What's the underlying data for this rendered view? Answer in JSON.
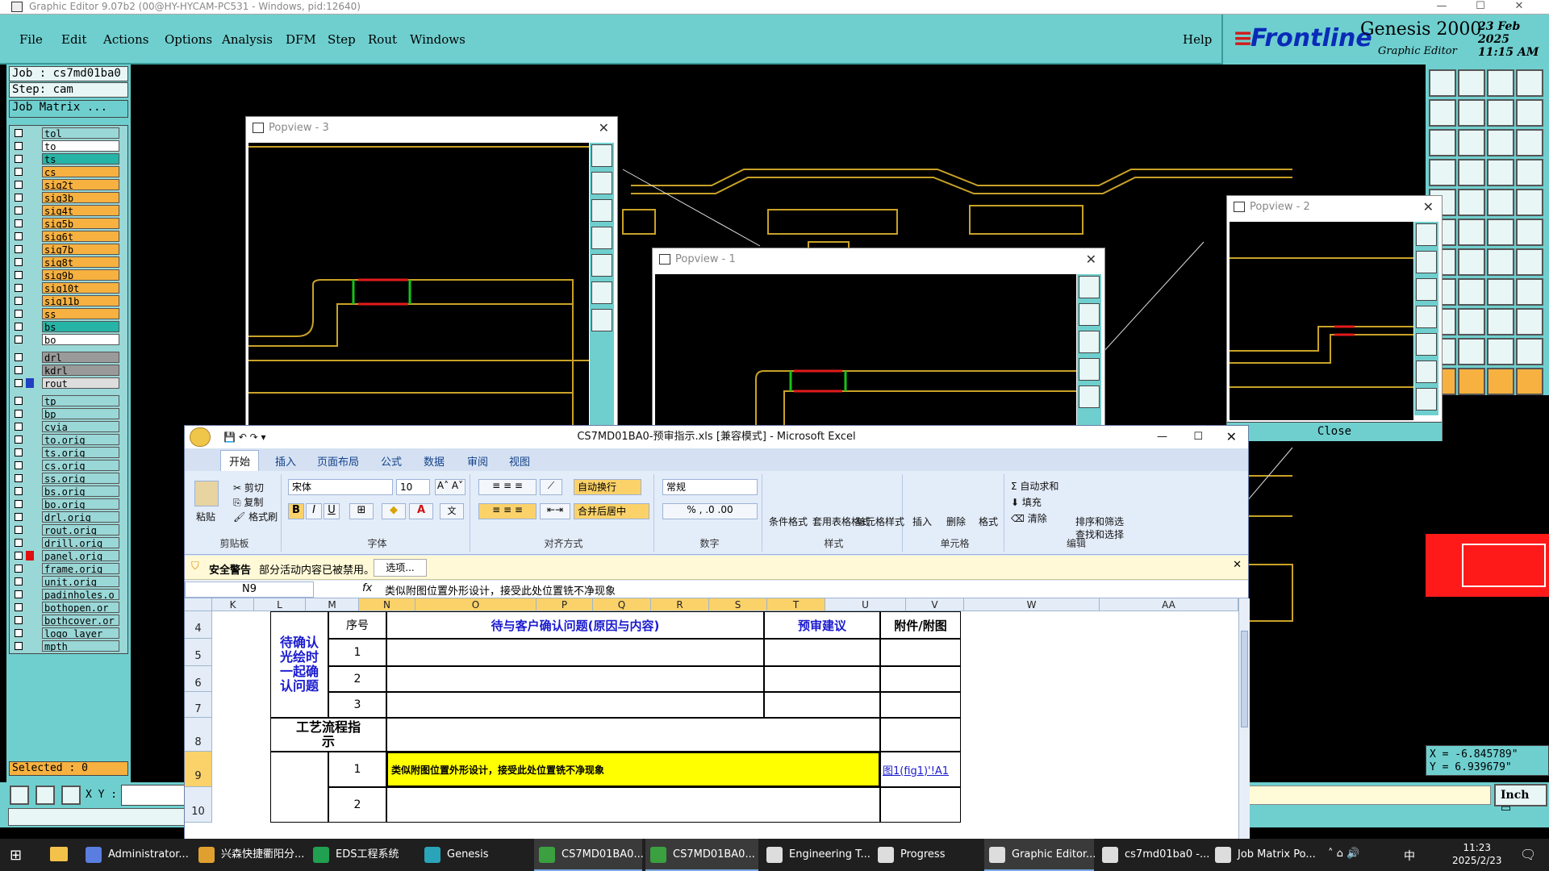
{
  "app_title": "Graphic Editor 9.07b2 (00@HY-HYCAM-PC531 - Windows, pid:12640)",
  "menu": [
    "File",
    "Edit",
    "Actions",
    "Options",
    "Analysis",
    "DFM",
    "Step",
    "Rout",
    "Windows"
  ],
  "help_label": "Help",
  "brand": {
    "logo": "Frontline",
    "product": "Genesis 2000",
    "subtitle": "Graphic Editor",
    "date": "23 Feb 2025",
    "time": "11:15 AM"
  },
  "job": {
    "job_line": "Job : cs7md01ba0",
    "step_line": "Step: cam",
    "matrix_button": "Job Matrix ..."
  },
  "layers": [
    {
      "name": "tol",
      "color": "#9ad7d7"
    },
    {
      "name": "to",
      "color": "#ffffff"
    },
    {
      "name": "ts",
      "color": "#26b4a6"
    },
    {
      "name": "cs",
      "color": "#f7b140"
    },
    {
      "name": "sig2t",
      "color": "#f7b140"
    },
    {
      "name": "sig3b",
      "color": "#f7b140"
    },
    {
      "name": "sig4t",
      "color": "#f7b140"
    },
    {
      "name": "sig5b",
      "color": "#f7b140"
    },
    {
      "name": "sig6t",
      "color": "#f7b140"
    },
    {
      "name": "sig7b",
      "color": "#f7b140"
    },
    {
      "name": "sig8t",
      "color": "#f7b140"
    },
    {
      "name": "sig9b",
      "color": "#f7b140"
    },
    {
      "name": "sig10t",
      "color": "#f7b140"
    },
    {
      "name": "sig11b",
      "color": "#f7b140"
    },
    {
      "name": "ss",
      "color": "#f7b140"
    },
    {
      "name": "bs",
      "color": "#26b4a6"
    },
    {
      "name": "bo",
      "color": "#ffffff"
    },
    {
      "name": "drl",
      "color": "#9a9a9a"
    },
    {
      "name": "kdrl",
      "color": "#9a9a9a"
    },
    {
      "name": "rout",
      "color": "#dddddd"
    },
    {
      "name": "tp",
      "color": "#9ad7d7"
    },
    {
      "name": "bp",
      "color": "#9ad7d7"
    },
    {
      "name": "cvia",
      "color": "#9ad7d7"
    },
    {
      "name": "to.orig",
      "color": "#9ad7d7"
    },
    {
      "name": "ts.orig",
      "color": "#9ad7d7"
    },
    {
      "name": "cs.orig",
      "color": "#9ad7d7"
    },
    {
      "name": "ss.orig",
      "color": "#9ad7d7"
    },
    {
      "name": "bs.orig",
      "color": "#9ad7d7"
    },
    {
      "name": "bo.orig",
      "color": "#9ad7d7"
    },
    {
      "name": "drl.orig",
      "color": "#9ad7d7"
    },
    {
      "name": "rout.orig",
      "color": "#9ad7d7"
    },
    {
      "name": "drill.orig",
      "color": "#9ad7d7"
    },
    {
      "name": "panel.orig",
      "color": "#9ad7d7"
    },
    {
      "name": "frame.orig",
      "color": "#9ad7d7"
    },
    {
      "name": "unit.orig",
      "color": "#9ad7d7"
    },
    {
      "name": "padinholes.o",
      "color": "#9ad7d7"
    },
    {
      "name": "bothopen.or",
      "color": "#9ad7d7"
    },
    {
      "name": "bothcover.or",
      "color": "#9ad7d7"
    },
    {
      "name": "logo_layer_",
      "color": "#9ad7d7"
    },
    {
      "name": "mpth",
      "color": "#9ad7d7"
    }
  ],
  "selected_label": "Selected : 0",
  "xy_label": "X Y :",
  "coords": {
    "x": "X = -6.845789\"",
    "y": "Y = 6.939679\""
  },
  "inch_label": "Inch",
  "popviews": [
    {
      "title": "Popview - 3"
    },
    {
      "title": "Popview - 1"
    },
    {
      "title": "Popview - 2"
    }
  ],
  "close_label": "Close",
  "excel": {
    "title": "CS7MD01BA0-预审指示.xls [兼容模式] - Microsoft Excel",
    "tabs": [
      "开始",
      "插入",
      "页面布局",
      "公式",
      "数据",
      "审阅",
      "视图"
    ],
    "clipboard": {
      "paste": "粘贴",
      "cut": "剪切",
      "copy": "复制",
      "format_painter": "格式刷",
      "group": "剪贴板"
    },
    "font": {
      "name": "宋体",
      "size": "10",
      "group": "字体"
    },
    "align": {
      "wrap": "自动换行",
      "merge": "合并后居中",
      "group": "对齐方式"
    },
    "number": {
      "format": "常规",
      "group": "数字"
    },
    "styles": {
      "cond": "条件格式",
      "table": "套用表格格式",
      "cell": "单元格样式",
      "group": "样式"
    },
    "cells": {
      "insert": "插入",
      "delete": "删除",
      "format": "格式",
      "group": "单元格"
    },
    "edit": {
      "autosum": "自动求和",
      "fill": "填充",
      "clear": "清除",
      "sort": "排序和筛选",
      "find": "查找和选择",
      "group": "编辑"
    },
    "security": {
      "label": "安全警告",
      "text": "部分活动内容已被禁用。",
      "button": "选项..."
    },
    "name_box": "N9",
    "formula": "类似附图位置外形设计，接受此处位置铣不净现象",
    "columns": [
      "K",
      "L",
      "M",
      "N",
      "O",
      "P",
      "Q",
      "R",
      "S",
      "T",
      "U",
      "V",
      "W",
      "AA"
    ],
    "rows": [
      "4",
      "5",
      "6",
      "7",
      "8",
      "9",
      "10"
    ],
    "cells_text": {
      "seq_header": "序号",
      "issue_header": "待与客户确认问题(原因与内容)",
      "suggest_header": "预审建议",
      "attach_header": "附件/附图",
      "pending_label": "待确认光绘时一起确认问题",
      "process_label": "工艺流程指示",
      "n1": "1",
      "n2": "2",
      "n3": "3",
      "p1": "1",
      "p2": "2",
      "issue_text": "类似附图位置外形设计，接受此处位置铣不净现象",
      "link_text": "图1(fig1)'!A1"
    }
  },
  "taskbar": {
    "items": [
      "Administrator...",
      "兴森快捷衢阳分...",
      "EDS工程系统",
      "Genesis",
      "CS7MD01BA0...",
      "CS7MD01BA0...",
      "Engineering T...",
      "Progress",
      "Graphic Editor...",
      "cs7md01ba0 -...",
      "Job Matrix Po..."
    ],
    "clock_time": "11:23",
    "clock_date": "2025/2/23",
    "ime": "中"
  }
}
